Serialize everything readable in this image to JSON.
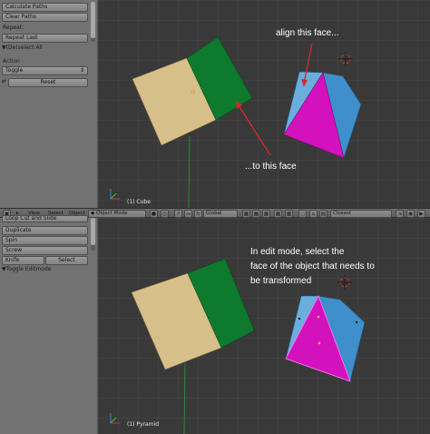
{
  "top_panel": {
    "calculate_paths": "Calculate Paths",
    "clear_paths": "Clear Paths",
    "repeat_heading": "Repeat:",
    "repeat_last": "Repeat Last",
    "deselect_all": "(De)select All",
    "action_label": "Action",
    "action_value": "Toggle",
    "reset": "Reset"
  },
  "header": {
    "view": "View",
    "select": "Select",
    "object": "Object",
    "mode": "Object Mode",
    "pivot": "Global",
    "snap": "Closest"
  },
  "bottom_panel": {
    "loop_cut": "Loop Cut and Slide",
    "duplicate": "Duplicate",
    "spin": "Spin",
    "screw": "Screw",
    "knife": "Knife",
    "select": "Select",
    "toggle_editmode": "Toggle Editmode"
  },
  "top_viewport": {
    "object_name": "(1) Cube",
    "annotation_1": "align this face...",
    "annotation_2": "...to this face"
  },
  "bottom_viewport": {
    "object_name": "(1) Pyramid",
    "annotation_lines": [
      "In edit mode, select the",
      "face of the object that needs to",
      "be transformed"
    ]
  },
  "colors": {
    "cube_tan": "#d7bf8a",
    "cube_green": "#0e7a2d",
    "pyramid_magenta": "#d312be",
    "pyramid_blue": "#3e8fcc",
    "arrow_red": "#d42a2a"
  },
  "icons": [
    "cursor-icon",
    "dropdown-icon",
    "triangle-icon",
    "view-menu-icon",
    "mode-icon",
    "shading-icon",
    "pivot-icon",
    "layer-icon",
    "snap-icon",
    "axis-icon"
  ]
}
